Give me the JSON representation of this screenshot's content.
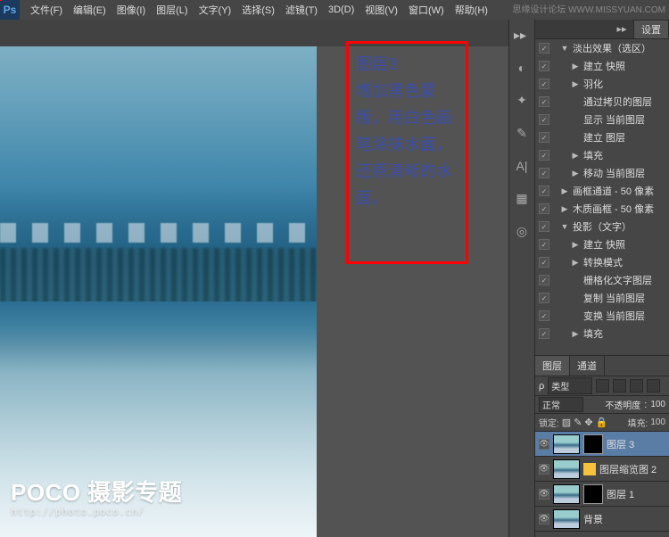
{
  "watermark": {
    "site": "思缘设计论坛",
    "url": "WWW.MISSYUAN.COM"
  },
  "menu": [
    "文件(F)",
    "编辑(E)",
    "图像(I)",
    "图层(L)",
    "文字(Y)",
    "选择(S)",
    "滤镜(T)",
    "3D(D)",
    "视图(V)",
    "窗口(W)",
    "帮助(H)"
  ],
  "logo": {
    "brand": "Ps",
    "main": "POCO 摄影专题",
    "url": "http://photo.poco.cn/"
  },
  "annotation": {
    "title": "图层3:",
    "body": "增加黑色蒙版，用白色画笔涂抹水面，还原清晰的水面。"
  },
  "rightIcons": [
    "history-icon",
    "compass-icon",
    "brush-icon",
    "text-icon",
    "swatch-icon",
    "cc-icon"
  ],
  "settingsTab": "设置",
  "actions": [
    {
      "vis": true,
      "indent": 0,
      "tri": "▼",
      "label": "淡出效果（选区）"
    },
    {
      "vis": true,
      "indent": 1,
      "tri": "▶",
      "label": "建立 快照"
    },
    {
      "vis": true,
      "indent": 1,
      "tri": "▶",
      "label": "羽化"
    },
    {
      "vis": true,
      "indent": 1,
      "tri": "",
      "label": "通过拷贝的图层"
    },
    {
      "vis": true,
      "indent": 1,
      "tri": "",
      "label": "显示 当前图层"
    },
    {
      "vis": true,
      "indent": 1,
      "tri": "",
      "label": "建立 图层"
    },
    {
      "vis": true,
      "indent": 1,
      "tri": "▶",
      "label": "填充"
    },
    {
      "vis": true,
      "indent": 1,
      "tri": "▶",
      "label": "移动 当前图层"
    },
    {
      "vis": true,
      "indent": 0,
      "tri": "▶",
      "label": "画框通道 - 50 像素"
    },
    {
      "vis": true,
      "indent": 0,
      "tri": "▶",
      "label": "木质画框 - 50 像素"
    },
    {
      "vis": true,
      "indent": 0,
      "tri": "▼",
      "label": "投影（文字）"
    },
    {
      "vis": true,
      "indent": 1,
      "tri": "▶",
      "label": "建立 快照"
    },
    {
      "vis": true,
      "indent": 1,
      "tri": "▶",
      "label": "转换模式"
    },
    {
      "vis": true,
      "indent": 1,
      "tri": "",
      "label": "栅格化文字图层"
    },
    {
      "vis": true,
      "indent": 1,
      "tri": "",
      "label": "复制 当前图层"
    },
    {
      "vis": true,
      "indent": 1,
      "tri": "",
      "label": "变换 当前图层"
    },
    {
      "vis": true,
      "indent": 1,
      "tri": "▶",
      "label": "填充"
    }
  ],
  "layersPanel": {
    "tabs": [
      "图层",
      "通道"
    ],
    "kind": "类型",
    "blendMode": "正常",
    "opacity": "不透明度",
    "opVal": "100",
    "lockLbl": "锁定:",
    "fillLbl": "填充:",
    "fillVal": "100"
  },
  "layers": [
    {
      "name": "图层 3",
      "sel": true,
      "mask": "black"
    },
    {
      "name": "图层缩览图 2",
      "sel": false,
      "warn": true
    },
    {
      "name": "图层 1",
      "sel": false,
      "mask": "black"
    },
    {
      "name": "背景",
      "sel": false
    }
  ]
}
